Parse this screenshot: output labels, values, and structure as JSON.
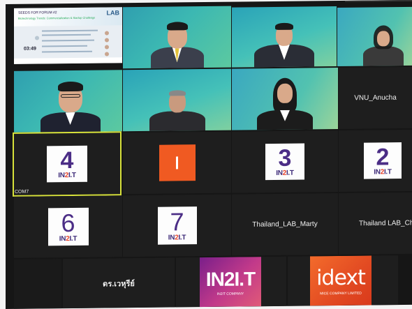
{
  "slide": {
    "title": "SEEDS FOR FORUM #2",
    "subtitle": "Biotechnology Trends: Commercialization & Startup Challenges and Opportunities",
    "logo": "LAB",
    "time": "03:49"
  },
  "participants": {
    "vnu": "VNU_Anucha",
    "com7": "COM7",
    "marty": "Thailand_LAB_Marty",
    "lab_cha": "Thailand LAB_Cha",
    "thai_name": "ดร.เวหุรีย์"
  },
  "cards": {
    "c4": {
      "num": "4",
      "brand_a": "IN",
      "brand_b": "2",
      "brand_c": "I.T"
    },
    "c3": {
      "num": "3",
      "brand_a": "IN",
      "brand_b": "2",
      "brand_c": "I.T"
    },
    "c2": {
      "num": "2",
      "brand_a": "IN",
      "brand_b": "2",
      "brand_c": "I.T"
    },
    "c6": {
      "num": "6",
      "brand_a": "IN",
      "brand_b": "2",
      "brand_c": "I.T"
    },
    "c7": {
      "num": "7",
      "brand_a": "IN",
      "brand_b": "2",
      "brand_c": "I.T"
    }
  },
  "logos": {
    "in2it_big": "IN2I.T",
    "in2it_small": "IN2IT COMPANY",
    "idext_big": "idext",
    "idext_small": "MICE COMPANY LIMITED"
  }
}
